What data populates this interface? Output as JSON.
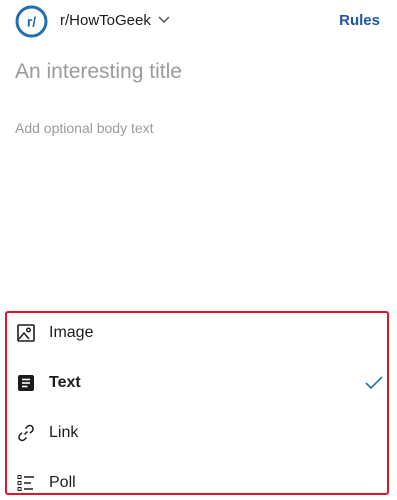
{
  "header": {
    "community_badge": "r/",
    "community_name": "r/HowToGeek",
    "rules_label": "Rules"
  },
  "compose": {
    "title_placeholder": "An interesting title",
    "body_placeholder": "Add optional body text"
  },
  "post_types": [
    {
      "label": "Image",
      "icon": "image-icon",
      "selected": false
    },
    {
      "label": "Text",
      "icon": "text-icon",
      "selected": true
    },
    {
      "label": "Link",
      "icon": "link-icon",
      "selected": false
    },
    {
      "label": "Poll",
      "icon": "poll-icon",
      "selected": false
    }
  ],
  "colors": {
    "accent": "#1f57a0",
    "highlight_border": "#e0152a",
    "placeholder": "#9b9b9b",
    "check": "#1f6fb2"
  }
}
